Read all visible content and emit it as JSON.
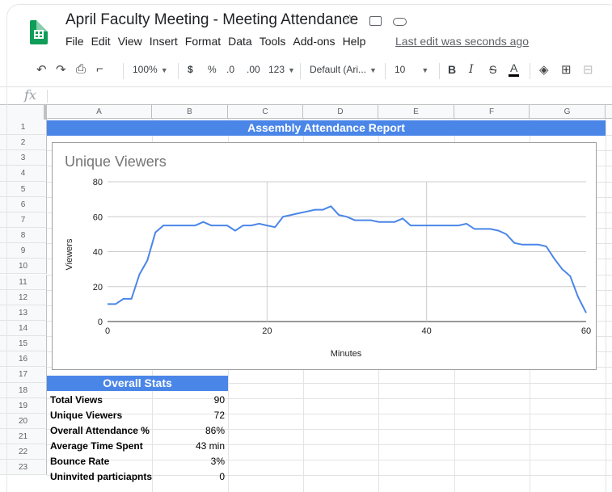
{
  "document": {
    "title": "April Faculty Meeting - Meeting Attendance",
    "last_edit": "Last edit was seconds ago"
  },
  "menu": [
    "File",
    "Edit",
    "View",
    "Insert",
    "Format",
    "Data",
    "Tools",
    "Add-ons",
    "Help"
  ],
  "toolbar": {
    "zoom": "100%",
    "currency": "$",
    "percent": "%",
    "decrease_decimal": ".0",
    "increase_decimal": ".00",
    "number_format": "123",
    "font": "Default (Ari...",
    "font_size": "10",
    "bold": "B",
    "italic": "I",
    "strike": "S",
    "text_color": "A"
  },
  "formula_bar": {
    "fx": "fx",
    "value": ""
  },
  "columns": [
    "A",
    "B",
    "C",
    "D",
    "E",
    "F",
    "G"
  ],
  "rows": [
    "1",
    "2",
    "3",
    "4",
    "5",
    "6",
    "7",
    "8",
    "9",
    "10",
    "11",
    "12",
    "13",
    "14",
    "15",
    "16",
    "17",
    "18",
    "19",
    "20",
    "21",
    "22",
    "23"
  ],
  "sheet": {
    "report_title": "Assembly Attendance Report",
    "stats_header": "Overall Stats",
    "stats": [
      {
        "label": "Total Views",
        "value": "90"
      },
      {
        "label": "Unique Viewers",
        "value": "72"
      },
      {
        "label": "Overall Attendance %",
        "value": "86%"
      },
      {
        "label": "Average Time Spent",
        "value": "43 min"
      },
      {
        "label": "Bounce Rate",
        "value": "3%"
      },
      {
        "label": "Uninvited particiapnts",
        "value": "0"
      }
    ]
  },
  "colors": {
    "accent": "#4a86e8",
    "line": "#4a86e8",
    "sheets_green": "#0f9d58"
  },
  "chart_data": {
    "type": "line",
    "title": "Unique Viewers",
    "xlabel": "Minutes",
    "ylabel": "Viewers",
    "xlim": [
      0,
      60
    ],
    "ylim": [
      0,
      80
    ],
    "x_ticks": [
      "0",
      "20",
      "40",
      "60"
    ],
    "y_ticks": [
      "0",
      "20",
      "40",
      "60",
      "80"
    ],
    "grid": true,
    "legend": "none",
    "series": [
      {
        "x": [
          0,
          1,
          2,
          3,
          4,
          5,
          6,
          7,
          8,
          9,
          10,
          11,
          12,
          13,
          14,
          15,
          16,
          17,
          18,
          19,
          20,
          21,
          22,
          23,
          24,
          25,
          26,
          27,
          28,
          29,
          30,
          31,
          32,
          33,
          34,
          35,
          36,
          37,
          38,
          39,
          40,
          41,
          42,
          43,
          44,
          45,
          46,
          47,
          48,
          49,
          50,
          51,
          52,
          53,
          54,
          55,
          56,
          57,
          58,
          59,
          60
        ],
        "values": [
          10,
          10,
          13,
          13,
          27,
          35,
          51,
          55,
          55,
          55,
          55,
          55,
          57,
          55,
          55,
          55,
          52,
          55,
          55,
          56,
          55,
          54,
          60,
          61,
          62,
          63,
          64,
          64,
          66,
          61,
          60,
          58,
          58,
          58,
          57,
          57,
          57,
          59,
          55,
          55,
          55,
          55,
          55,
          55,
          55,
          56,
          53,
          53,
          53,
          52,
          50,
          45,
          44,
          44,
          44,
          43,
          36,
          30,
          26,
          14,
          5
        ]
      }
    ]
  }
}
